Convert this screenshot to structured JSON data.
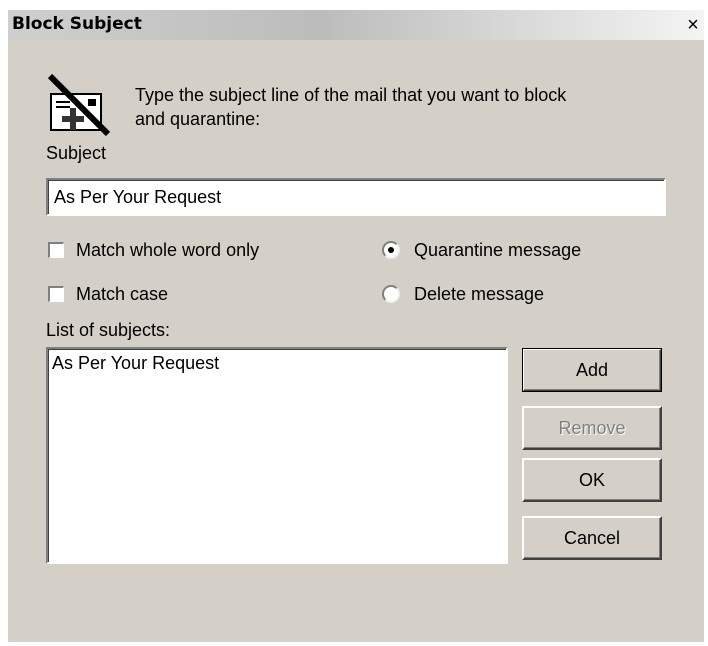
{
  "window": {
    "title": "Block Subject",
    "close_symbol": "×"
  },
  "instruction_line1": "Type the subject line of the mail that you want to block",
  "instruction_line2": "and quarantine:",
  "subject": {
    "label": "Subject",
    "value": "As Per Your Request"
  },
  "options": {
    "match_whole_word": {
      "label": "Match whole word only",
      "checked": false
    },
    "match_case": {
      "label": "Match case",
      "checked": false
    },
    "quarantine": {
      "label": "Quarantine message",
      "selected": true
    },
    "delete": {
      "label": "Delete message",
      "selected": false
    }
  },
  "list": {
    "label": "List of subjects:",
    "items": [
      "As Per Your Request"
    ]
  },
  "buttons": {
    "add": "Add",
    "remove": "Remove",
    "ok": "OK",
    "cancel": "Cancel"
  },
  "icons": {
    "header_icon": "blocked-mail-icon"
  }
}
